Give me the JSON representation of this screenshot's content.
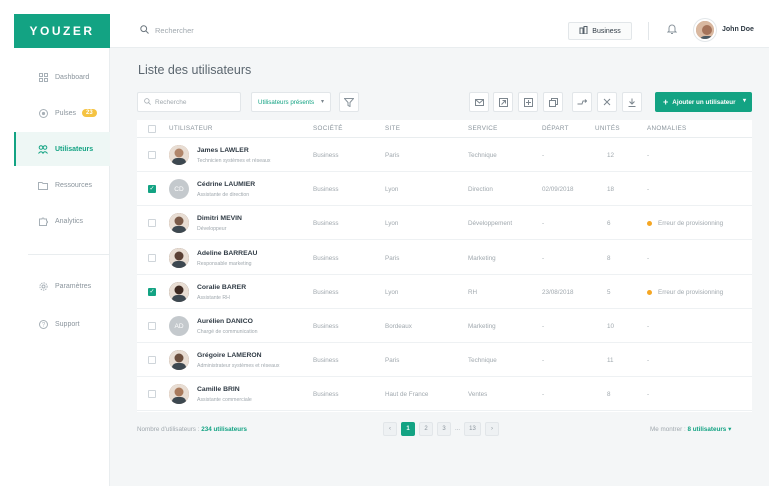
{
  "app": {
    "logo": "YOUZER"
  },
  "sidebar": {
    "items": [
      {
        "label": "Dashboard",
        "icon": "grid-icon"
      },
      {
        "label": "Pulses",
        "icon": "target-icon",
        "badge": "23"
      },
      {
        "label": "Utilisateurs",
        "icon": "users-icon"
      },
      {
        "label": "Ressources",
        "icon": "folder-icon"
      },
      {
        "label": "Analytics",
        "icon": "puzzle-icon"
      },
      {
        "label": "Paramètres",
        "icon": "gear-icon"
      },
      {
        "label": "Support",
        "icon": "help-icon"
      }
    ]
  },
  "topbar": {
    "search_placeholder": "Rechercher",
    "org_button": "Business",
    "user_name": "John Doe"
  },
  "main": {
    "title": "Liste des utilisateurs",
    "filter_search_placeholder": "Recherche",
    "filter_select": "Utilisateurs présents",
    "add_button": "Ajouter un utilisateur"
  },
  "table": {
    "columns": [
      "UTILISATEUR",
      "SOCIÉTÉ",
      "SITE",
      "SERVICE",
      "DÉPART",
      "UNITÉS",
      "ANOMALIES"
    ],
    "rows": [
      {
        "checked": false,
        "initials": "",
        "avatar_color": "#b0856a",
        "name": "James LAWLER",
        "role": "Technicien systèmes et réseaux",
        "company": "Business",
        "site": "Paris",
        "service": "Technique",
        "depart": "-",
        "units": "12",
        "anomaly": "-",
        "anomaly_flag": false
      },
      {
        "checked": true,
        "initials": "CD",
        "avatar_color": "#c4c9cd",
        "name": "Cédrine LAUMIER",
        "role": "Assistante de direction",
        "company": "Business",
        "site": "Lyon",
        "service": "Direction",
        "depart": "02/09/2018",
        "units": "18",
        "anomaly": "-",
        "anomaly_flag": false
      },
      {
        "checked": false,
        "initials": "",
        "avatar_color": "#7a5a48",
        "name": "Dimitri MEVIN",
        "role": "Développeur",
        "company": "Business",
        "site": "Lyon",
        "service": "Développement",
        "depart": "-",
        "units": "6",
        "anomaly": "Erreur de provisionning",
        "anomaly_flag": true
      },
      {
        "checked": false,
        "initials": "",
        "avatar_color": "#5a4034",
        "name": "Adeline BARREAU",
        "role": "Responsable marketing",
        "company": "Business",
        "site": "Paris",
        "service": "Marketing",
        "depart": "-",
        "units": "8",
        "anomaly": "-",
        "anomaly_flag": false
      },
      {
        "checked": true,
        "initials": "",
        "avatar_color": "#3e2a22",
        "name": "Coralie BARER",
        "role": "Assistante RH",
        "company": "Business",
        "site": "Lyon",
        "service": "RH",
        "depart": "23/08/2018",
        "units": "5",
        "anomaly": "Erreur de provisionning",
        "anomaly_flag": true
      },
      {
        "checked": false,
        "initials": "AD",
        "avatar_color": "#c4c9cd",
        "name": "Aurélien DANICO",
        "role": "Chargé de communication",
        "company": "Business",
        "site": "Bordeaux",
        "service": "Marketing",
        "depart": "-",
        "units": "10",
        "anomaly": "-",
        "anomaly_flag": false
      },
      {
        "checked": false,
        "initials": "",
        "avatar_color": "#6b4e3d",
        "name": "Grégoire LAMERON",
        "role": "Administrateur systèmes et réseaux",
        "company": "Business",
        "site": "Paris",
        "service": "Technique",
        "depart": "-",
        "units": "11",
        "anomaly": "-",
        "anomaly_flag": false
      },
      {
        "checked": false,
        "initials": "",
        "avatar_color": "#a97a5c",
        "name": "Camille BRIN",
        "role": "Assistante commerciale",
        "company": "Business",
        "site": "Haut de France",
        "service": "Ventes",
        "depart": "-",
        "units": "8",
        "anomaly": "-",
        "anomaly_flag": false
      }
    ]
  },
  "footer": {
    "count_label": "Nombre d'utilisateurs :",
    "count_value": "234 utilisateurs",
    "pages": [
      "1",
      "2",
      "3",
      "13"
    ],
    "ellipsis": "...",
    "show_label": "Me montrer :",
    "show_value": "8 utilisateurs"
  },
  "colors": {
    "accent": "#13a383",
    "warning": "#f5a623",
    "badge": "#f5c342"
  }
}
